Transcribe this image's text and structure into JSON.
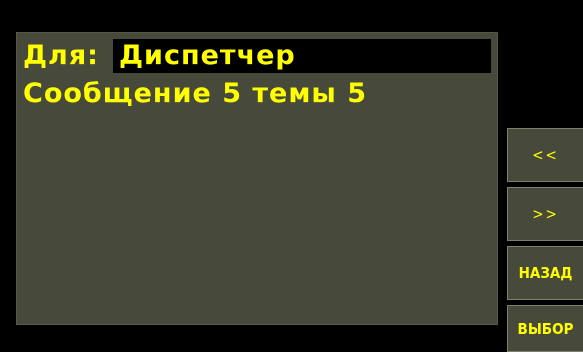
{
  "message": {
    "to_label": "Для:",
    "recipient": "Диспетчер",
    "title": "Сообщение 5 темы 5"
  },
  "side_buttons": {
    "prev_label": "<<",
    "next_label": ">>",
    "back_label": "НАЗАД",
    "select_label": "ВЫБОР"
  },
  "colors": {
    "background": "#000000",
    "panel": "#474a3a",
    "text": "#ffff00",
    "button_border": "#7e8264"
  }
}
